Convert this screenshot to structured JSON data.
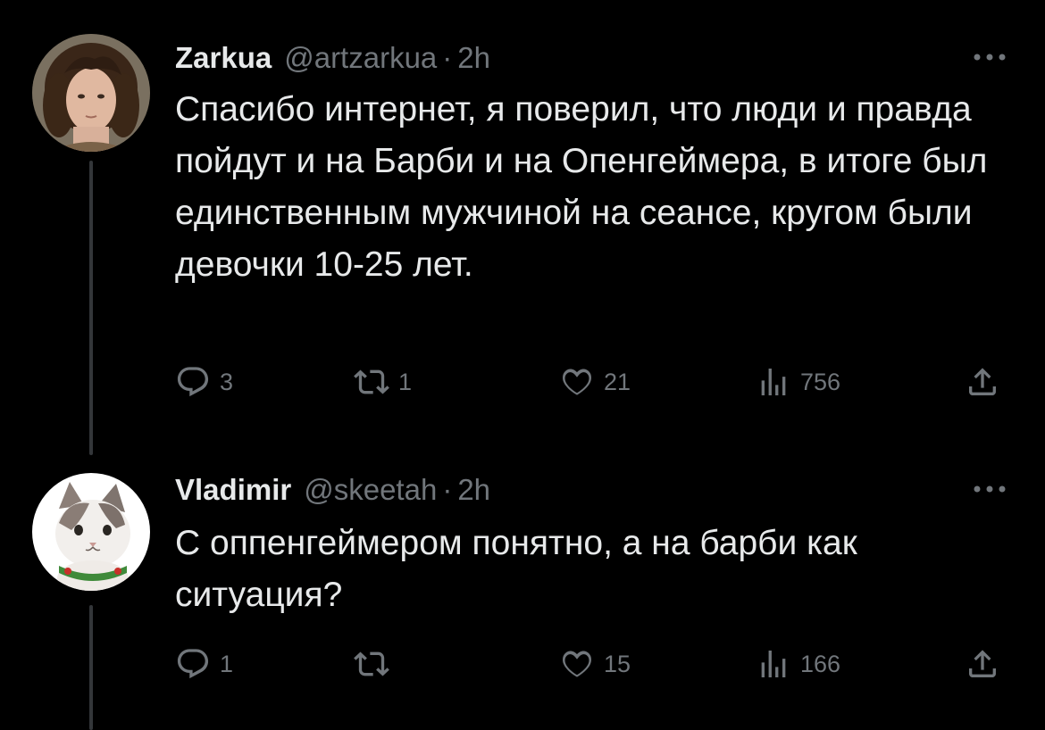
{
  "tweets": [
    {
      "author": {
        "display_name": "Zarkua",
        "handle": "@artzarkua",
        "time": "2h",
        "avatar_icon": "avatar-man-curly-hair"
      },
      "separator": "·",
      "text": "Спасибо интернет, я поверил, что люди и правда пойдут и на Барби и на Опенгеймера, в итоге был единственным мужчиной на сеансе, кругом были девочки 10-25 лет.",
      "actions": {
        "replies": "3",
        "retweets": "1",
        "likes": "21",
        "views": "756"
      }
    },
    {
      "author": {
        "display_name": "Vladimir",
        "handle": "@skeetah",
        "time": "2h",
        "avatar_icon": "avatar-cat"
      },
      "separator": "·",
      "text": "С оппенгеймером понятно, а на барби как ситуация?",
      "actions": {
        "replies": "1",
        "retweets": "",
        "likes": "15",
        "views": "166"
      }
    }
  ],
  "colors": {
    "background": "#000000",
    "primary_text": "#e7e9ea",
    "secondary_text": "#71767b",
    "thread_line": "#333639"
  }
}
